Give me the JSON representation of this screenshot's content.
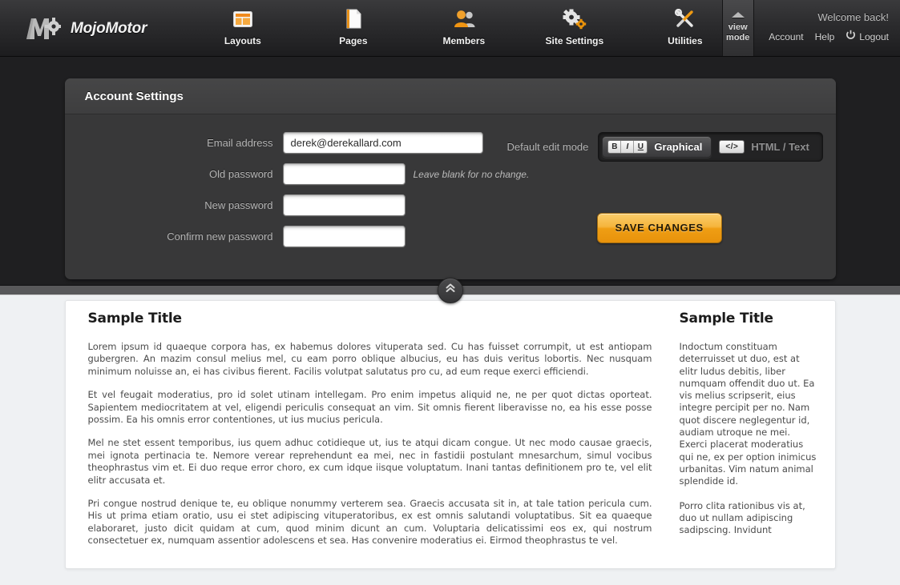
{
  "brand": {
    "name": "MojoMotor",
    "logo_icon": "mojo-m-gear-logo"
  },
  "nav": {
    "items": [
      {
        "label": "Layouts",
        "icon": "layouts-icon"
      },
      {
        "label": "Pages",
        "icon": "page-document-icon"
      },
      {
        "label": "Members",
        "icon": "members-people-icon"
      },
      {
        "label": "Site Settings",
        "icon": "gears-icon"
      },
      {
        "label": "Utilities",
        "icon": "wrench-screwdriver-icon"
      }
    ]
  },
  "view_mode": {
    "line1": "view",
    "line2": "mode",
    "icon": "triangle-up-icon"
  },
  "user": {
    "welcome": "Welcome back!",
    "account_label": "Account",
    "help_label": "Help",
    "logout_label": "Logout",
    "logout_icon": "power-icon"
  },
  "panel": {
    "title": "Account Settings",
    "fields": [
      {
        "label": "Email address",
        "value": "derek@derekallard.com",
        "type": "text",
        "hint": ""
      },
      {
        "label": "Old password",
        "value": "",
        "type": "password",
        "hint": "Leave blank for no change."
      },
      {
        "label": "New password",
        "value": "",
        "type": "password",
        "hint": ""
      },
      {
        "label": "Confirm new password",
        "value": "",
        "type": "password",
        "hint": ""
      }
    ],
    "edit_mode": {
      "label": "Default edit mode",
      "selected": "Graphical",
      "options": [
        {
          "label": "Graphical",
          "icon": "bold-italic-underline-icon",
          "active": true,
          "chips": [
            "B",
            "I",
            "U"
          ]
        },
        {
          "label": "HTML / Text",
          "icon": "code-tags-icon",
          "active": false,
          "chip_text": "</>"
        }
      ]
    },
    "save_label": "SAVE CHANGES"
  },
  "divider": {
    "collapse_icon": "chevron-double-up-icon"
  },
  "preview": {
    "main": {
      "title": "Sample Title",
      "paragraphs": [
        "Lorem ipsum id quaeque corpora has, ex habemus dolores vituperata sed. Cu has fuisset corrumpit, ut est antiopam gubergren. An mazim consul melius mel, cu eam porro oblique albucius, eu has duis veritus lobortis. Nec nusquam minimum noluisse an, ei has civibus fierent. Facilis volutpat salutatus pro cu, ad eum reque exerci efficiendi.",
        "Et vel feugait moderatius, pro id solet utinam intellegam. Pro enim impetus aliquid ne, ne per quot dictas oporteat. Sapientem mediocritatem at vel, eligendi periculis consequat an vim. Sit omnis fierent liberavisse no, ea his esse posse possim. Ea his omnis error contentiones, ut ius mucius pericula.",
        "Mel ne stet essent temporibus, ius quem adhuc cotidieque ut, ius te atqui dicam congue. Ut nec modo causae graecis, mei ignota pertinacia te. Nemore verear reprehendunt ea mei, nec in fastidii postulant mnesarchum, simul vocibus theophrastus vim et. Ei duo reque error choro, ex cum idque iisque voluptatum. Inani tantas definitionem pro te, vel elit elitr accusata et.",
        "Pri congue nostrud denique te, eu oblique nonummy verterem sea. Graecis accusata sit in, at tale tation pericula cum. His ut prima etiam oratio, usu ei stet adipiscing vituperatoribus, ex est omnis salutandi voluptatibus. Sit ea quaeque elaboraret, justo dicit quidam at cum, quod minim dicunt an cum. Voluptaria delicatissimi eos ex, qui nostrum consectetuer ex, numquam assentior adolescens et sea. Has convenire moderatius ei. Eirmod theophrastus te vel."
      ]
    },
    "side": {
      "title": "Sample Title",
      "paragraphs": [
        "Indoctum constituam deterruisset ut duo, est at elitr ludus debitis, liber numquam offendit duo ut. Ea vis melius scripserit, eius integre percipit per no. Nam quot discere neglegentur id, audiam utroque ne mei. Exerci placerat moderatius qui ne, ex per option inimicus urbanitas. Vim natum animal splendide id.",
        "Porro clita rationibus vis at, duo ut nullam adipiscing sadipscing. Invidunt"
      ]
    }
  },
  "colors": {
    "accent_orange": "#ef9e14",
    "topbar_dark": "#2c2c2e",
    "panel_bg": "#383839",
    "panel_region": "#1f1f21",
    "page_bg": "#eff1f3"
  }
}
